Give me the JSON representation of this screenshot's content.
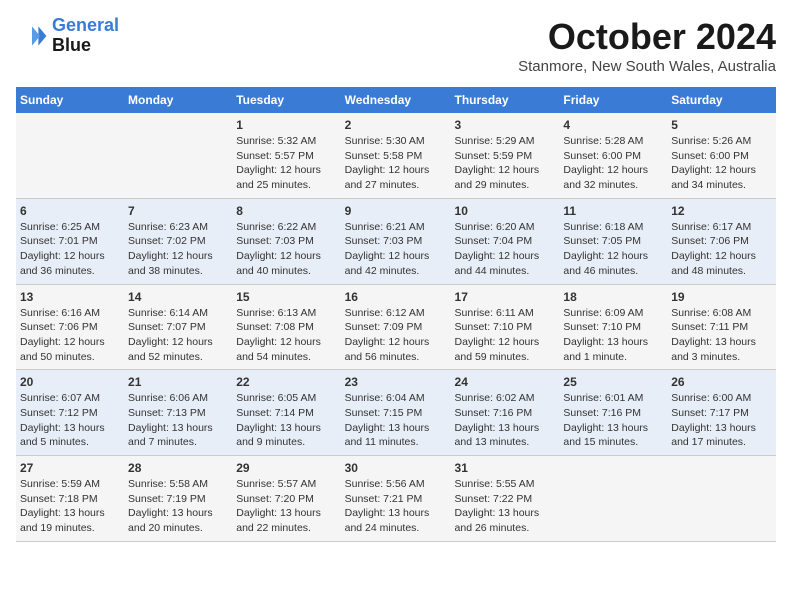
{
  "header": {
    "logo_line1": "General",
    "logo_line2": "Blue",
    "month": "October 2024",
    "location": "Stanmore, New South Wales, Australia"
  },
  "weekdays": [
    "Sunday",
    "Monday",
    "Tuesday",
    "Wednesday",
    "Thursday",
    "Friday",
    "Saturday"
  ],
  "weeks": [
    [
      {
        "day": "",
        "info": ""
      },
      {
        "day": "",
        "info": ""
      },
      {
        "day": "1",
        "info": "Sunrise: 5:32 AM\nSunset: 5:57 PM\nDaylight: 12 hours\nand 25 minutes."
      },
      {
        "day": "2",
        "info": "Sunrise: 5:30 AM\nSunset: 5:58 PM\nDaylight: 12 hours\nand 27 minutes."
      },
      {
        "day": "3",
        "info": "Sunrise: 5:29 AM\nSunset: 5:59 PM\nDaylight: 12 hours\nand 29 minutes."
      },
      {
        "day": "4",
        "info": "Sunrise: 5:28 AM\nSunset: 6:00 PM\nDaylight: 12 hours\nand 32 minutes."
      },
      {
        "day": "5",
        "info": "Sunrise: 5:26 AM\nSunset: 6:00 PM\nDaylight: 12 hours\nand 34 minutes."
      }
    ],
    [
      {
        "day": "6",
        "info": "Sunrise: 6:25 AM\nSunset: 7:01 PM\nDaylight: 12 hours\nand 36 minutes."
      },
      {
        "day": "7",
        "info": "Sunrise: 6:23 AM\nSunset: 7:02 PM\nDaylight: 12 hours\nand 38 minutes."
      },
      {
        "day": "8",
        "info": "Sunrise: 6:22 AM\nSunset: 7:03 PM\nDaylight: 12 hours\nand 40 minutes."
      },
      {
        "day": "9",
        "info": "Sunrise: 6:21 AM\nSunset: 7:03 PM\nDaylight: 12 hours\nand 42 minutes."
      },
      {
        "day": "10",
        "info": "Sunrise: 6:20 AM\nSunset: 7:04 PM\nDaylight: 12 hours\nand 44 minutes."
      },
      {
        "day": "11",
        "info": "Sunrise: 6:18 AM\nSunset: 7:05 PM\nDaylight: 12 hours\nand 46 minutes."
      },
      {
        "day": "12",
        "info": "Sunrise: 6:17 AM\nSunset: 7:06 PM\nDaylight: 12 hours\nand 48 minutes."
      }
    ],
    [
      {
        "day": "13",
        "info": "Sunrise: 6:16 AM\nSunset: 7:06 PM\nDaylight: 12 hours\nand 50 minutes."
      },
      {
        "day": "14",
        "info": "Sunrise: 6:14 AM\nSunset: 7:07 PM\nDaylight: 12 hours\nand 52 minutes."
      },
      {
        "day": "15",
        "info": "Sunrise: 6:13 AM\nSunset: 7:08 PM\nDaylight: 12 hours\nand 54 minutes."
      },
      {
        "day": "16",
        "info": "Sunrise: 6:12 AM\nSunset: 7:09 PM\nDaylight: 12 hours\nand 56 minutes."
      },
      {
        "day": "17",
        "info": "Sunrise: 6:11 AM\nSunset: 7:10 PM\nDaylight: 12 hours\nand 59 minutes."
      },
      {
        "day": "18",
        "info": "Sunrise: 6:09 AM\nSunset: 7:10 PM\nDaylight: 13 hours\nand 1 minute."
      },
      {
        "day": "19",
        "info": "Sunrise: 6:08 AM\nSunset: 7:11 PM\nDaylight: 13 hours\nand 3 minutes."
      }
    ],
    [
      {
        "day": "20",
        "info": "Sunrise: 6:07 AM\nSunset: 7:12 PM\nDaylight: 13 hours\nand 5 minutes."
      },
      {
        "day": "21",
        "info": "Sunrise: 6:06 AM\nSunset: 7:13 PM\nDaylight: 13 hours\nand 7 minutes."
      },
      {
        "day": "22",
        "info": "Sunrise: 6:05 AM\nSunset: 7:14 PM\nDaylight: 13 hours\nand 9 minutes."
      },
      {
        "day": "23",
        "info": "Sunrise: 6:04 AM\nSunset: 7:15 PM\nDaylight: 13 hours\nand 11 minutes."
      },
      {
        "day": "24",
        "info": "Sunrise: 6:02 AM\nSunset: 7:16 PM\nDaylight: 13 hours\nand 13 minutes."
      },
      {
        "day": "25",
        "info": "Sunrise: 6:01 AM\nSunset: 7:16 PM\nDaylight: 13 hours\nand 15 minutes."
      },
      {
        "day": "26",
        "info": "Sunrise: 6:00 AM\nSunset: 7:17 PM\nDaylight: 13 hours\nand 17 minutes."
      }
    ],
    [
      {
        "day": "27",
        "info": "Sunrise: 5:59 AM\nSunset: 7:18 PM\nDaylight: 13 hours\nand 19 minutes."
      },
      {
        "day": "28",
        "info": "Sunrise: 5:58 AM\nSunset: 7:19 PM\nDaylight: 13 hours\nand 20 minutes."
      },
      {
        "day": "29",
        "info": "Sunrise: 5:57 AM\nSunset: 7:20 PM\nDaylight: 13 hours\nand 22 minutes."
      },
      {
        "day": "30",
        "info": "Sunrise: 5:56 AM\nSunset: 7:21 PM\nDaylight: 13 hours\nand 24 minutes."
      },
      {
        "day": "31",
        "info": "Sunrise: 5:55 AM\nSunset: 7:22 PM\nDaylight: 13 hours\nand 26 minutes."
      },
      {
        "day": "",
        "info": ""
      },
      {
        "day": "",
        "info": ""
      }
    ]
  ]
}
